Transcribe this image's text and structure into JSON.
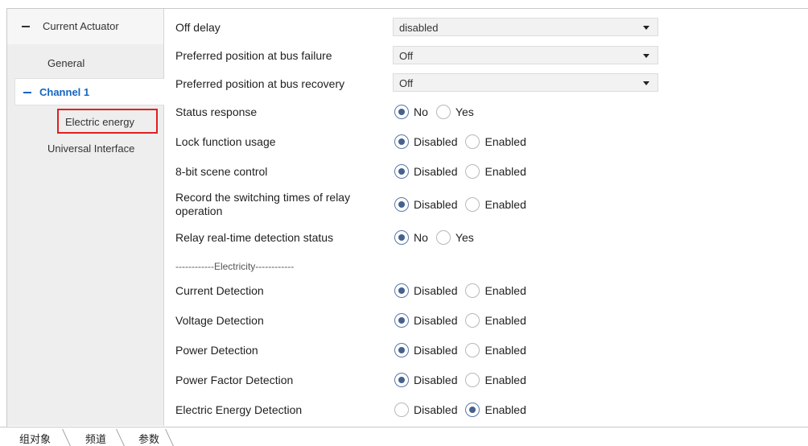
{
  "sidebar": {
    "root_label": "Current Actuator",
    "general_label": "General",
    "channel_label": "Channel 1",
    "energy_label": "Electric energy",
    "universal_label": "Universal Interface"
  },
  "params": {
    "off_delay": {
      "label": "Off delay",
      "value": "disabled"
    },
    "bus_failure": {
      "label": "Preferred position at bus failure",
      "value": "Off"
    },
    "bus_recovery": {
      "label": "Preferred position at bus recovery",
      "value": "Off"
    },
    "status_response": {
      "label": "Status response",
      "opt1": "No",
      "opt2": "Yes",
      "selected": 1
    },
    "lock_function": {
      "label": "Lock function usage",
      "opt1": "Disabled",
      "opt2": "Enabled",
      "selected": 1
    },
    "scene_control": {
      "label": "8-bit scene control",
      "opt1": "Disabled",
      "opt2": "Enabled",
      "selected": 1
    },
    "record_switching": {
      "label": "Record the switching times of relay operation",
      "opt1": "Disabled",
      "opt2": "Enabled",
      "selected": 1
    },
    "relay_detection": {
      "label": "Relay real-time detection status",
      "opt1": "No",
      "opt2": "Yes",
      "selected": 1
    },
    "separator": "------------Electricity------------",
    "current_detection": {
      "label": "Current Detection",
      "opt1": "Disabled",
      "opt2": "Enabled",
      "selected": 1
    },
    "voltage_detection": {
      "label": "Voltage Detection",
      "opt1": "Disabled",
      "opt2": "Enabled",
      "selected": 1
    },
    "power_detection": {
      "label": "Power Detection",
      "opt1": "Disabled",
      "opt2": "Enabled",
      "selected": 1
    },
    "power_factor_detection": {
      "label": "Power Factor Detection",
      "opt1": "Disabled",
      "opt2": "Enabled",
      "selected": 1
    },
    "energy_detection": {
      "label": "Electric Energy Detection",
      "opt1": "Disabled",
      "opt2": "Enabled",
      "selected": 2
    }
  },
  "tabs": {
    "group_objects": "组对象",
    "channels": "频道",
    "parameters": "参数"
  }
}
